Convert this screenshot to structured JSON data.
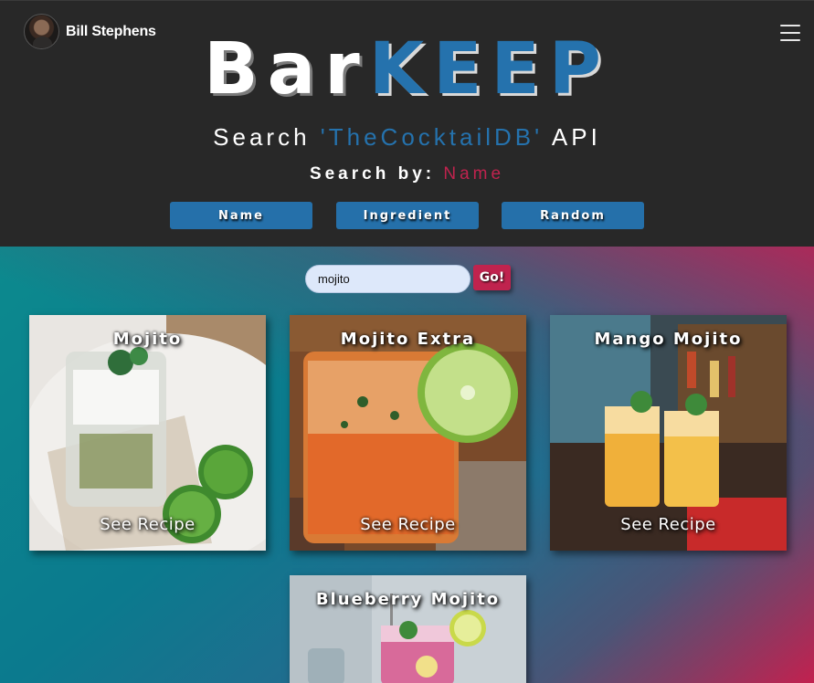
{
  "user": {
    "name": "Bill Stephens",
    "avatar_icon": "user-avatar"
  },
  "menu_icon": "hamburger-icon",
  "logo": {
    "part1": "Bar",
    "part2": "KEEP"
  },
  "subtitle": {
    "prefix": "Search",
    "api_name": "'TheCocktailDB'",
    "suffix": "API"
  },
  "search_by": {
    "label": "Search by:",
    "mode": "Name"
  },
  "mode_buttons": [
    "Name",
    "Ingredient",
    "Random"
  ],
  "search": {
    "value": "mojito",
    "go_label": "Go!"
  },
  "results": [
    {
      "title": "Mojito",
      "link": "See Recipe"
    },
    {
      "title": "Mojito Extra",
      "link": "See Recipe"
    },
    {
      "title": "Mango Mojito",
      "link": "See Recipe"
    },
    {
      "title": "Blueberry Mojito",
      "link": ""
    }
  ],
  "colors": {
    "accent_blue": "#2572ad",
    "accent_red": "#c0234e",
    "header_bg": "#282828"
  }
}
